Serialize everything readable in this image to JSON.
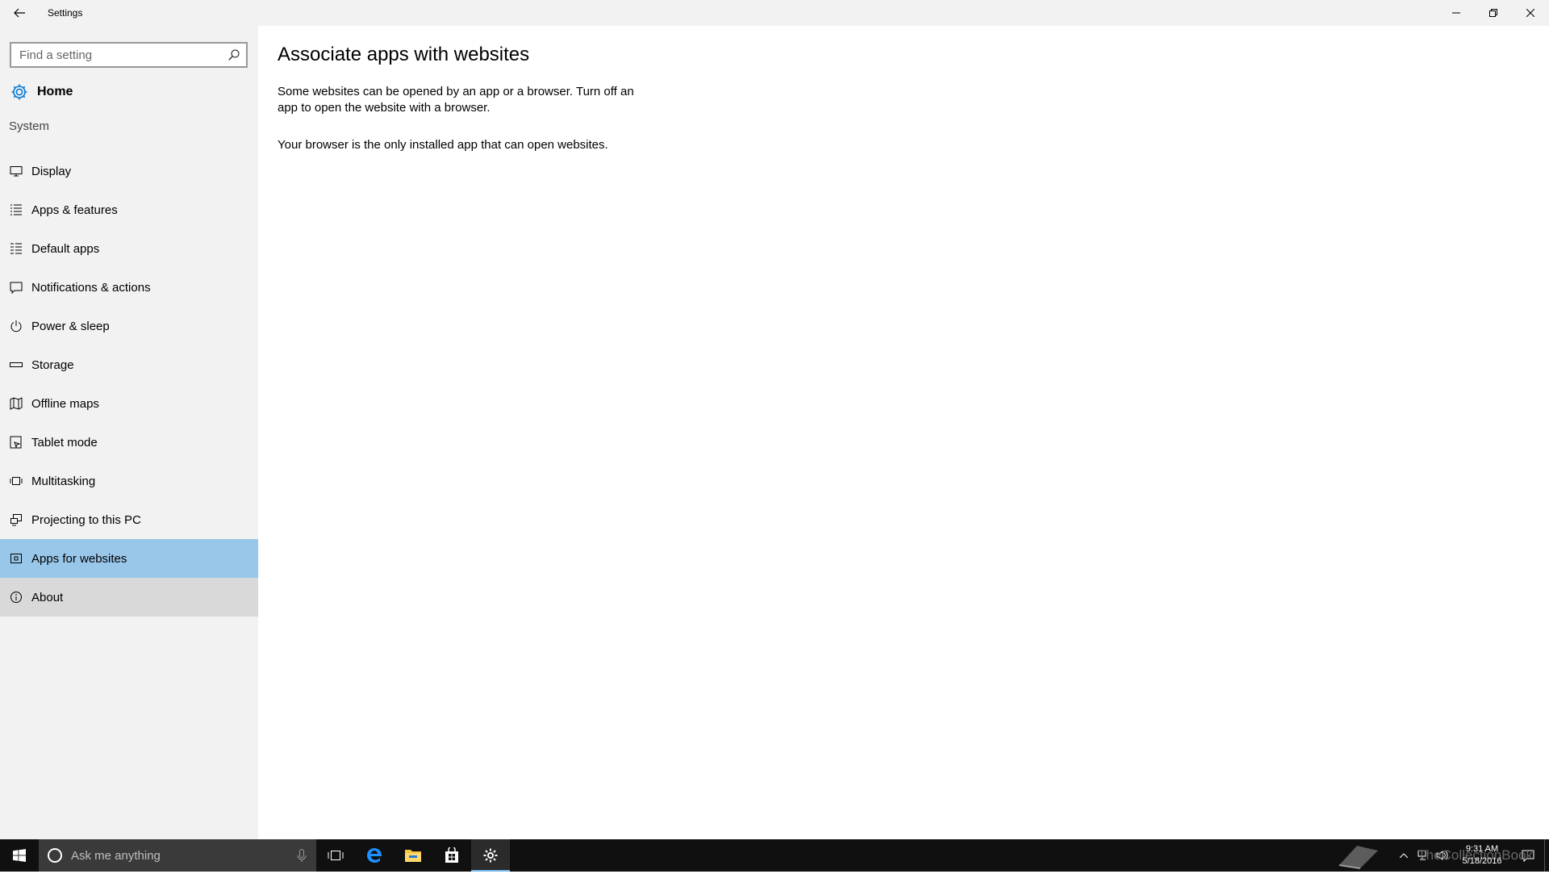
{
  "window": {
    "title": "Settings"
  },
  "sidebar": {
    "search_placeholder": "Find a setting",
    "home_label": "Home",
    "section_label": "System",
    "items": [
      {
        "label": "Display",
        "icon": "display-icon"
      },
      {
        "label": "Apps & features",
        "icon": "list-icon"
      },
      {
        "label": "Default apps",
        "icon": "default-apps-icon"
      },
      {
        "label": "Notifications & actions",
        "icon": "notifications-icon"
      },
      {
        "label": "Power & sleep",
        "icon": "power-icon"
      },
      {
        "label": "Storage",
        "icon": "storage-icon"
      },
      {
        "label": "Offline maps",
        "icon": "map-icon"
      },
      {
        "label": "Tablet mode",
        "icon": "tablet-icon"
      },
      {
        "label": "Multitasking",
        "icon": "multitasking-icon"
      },
      {
        "label": "Projecting to this PC",
        "icon": "projecting-icon"
      },
      {
        "label": "Apps for websites",
        "icon": "apps-websites-icon",
        "selected": true
      },
      {
        "label": "About",
        "icon": "info-icon"
      }
    ]
  },
  "main": {
    "heading": "Associate apps with websites",
    "description": "Some websites can be opened by an app or a browser.  Turn off an app to open the website with a browser.",
    "status": "Your browser is the only installed app that can open websites."
  },
  "taskbar": {
    "search_text": "Ask me anything",
    "clock_time": "9:31 AM",
    "clock_date": "5/18/2016",
    "watermark": "TheCollectionBook"
  },
  "colors": {
    "selected": "#99c7ea",
    "accent": "#0078d7",
    "sidebar_bg": "#f2f2f2",
    "taskbar_bg": "#101010"
  }
}
